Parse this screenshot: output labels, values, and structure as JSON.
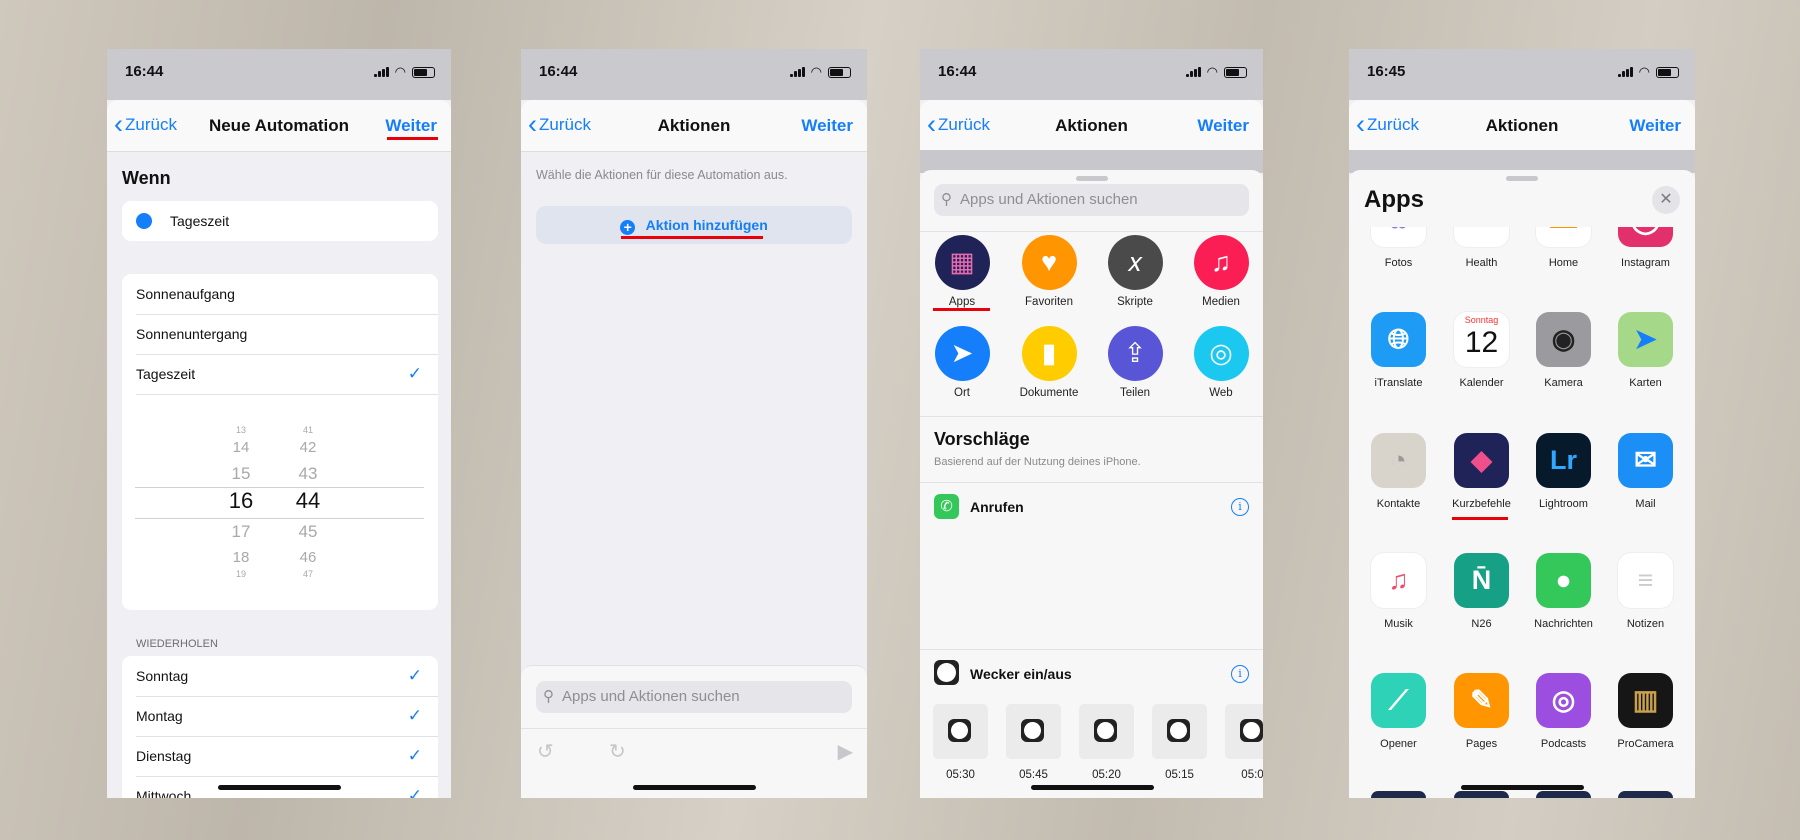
{
  "colors": {
    "accent": "#157efb",
    "highlight": "#e8000b"
  },
  "screens": [
    {
      "time": "16:44",
      "nav": {
        "back": "Zurück",
        "title": "Neue Automation",
        "next": "Weiter"
      },
      "when_header": "Wenn",
      "trigger": "Tageszeit",
      "options": [
        "Sonnenaufgang",
        "Sonnenuntergang",
        "Tageszeit"
      ],
      "selected_option": "Tageszeit",
      "picker": {
        "hours": [
          "13",
          "14",
          "15",
          "16",
          "17",
          "18",
          "19"
        ],
        "minutes": [
          "41",
          "42",
          "43",
          "44",
          "45",
          "46",
          "47"
        ],
        "selected": "16:44"
      },
      "repeat_header": "WIEDERHOLEN",
      "days": [
        "Sonntag",
        "Montag",
        "Dienstag",
        "Mittwoch"
      ]
    },
    {
      "time": "16:44",
      "nav": {
        "back": "Zurück",
        "title": "Aktionen",
        "next": "Weiter"
      },
      "subtitle": "Wähle die Aktionen für diese Automation aus.",
      "add_action": "Aktion hinzufügen",
      "search_placeholder": "Apps und Aktionen suchen"
    },
    {
      "time": "16:44",
      "nav": {
        "back": "Zurück",
        "title": "Aktionen",
        "next": "Weiter"
      },
      "search_placeholder": "Apps und Aktionen suchen",
      "categories": [
        {
          "label": "Apps",
          "icon": "apps-grid-icon",
          "color": "#1f2357"
        },
        {
          "label": "Favoriten",
          "icon": "heart-icon",
          "color": "#ff9500"
        },
        {
          "label": "Skripte",
          "icon": "script-x-icon",
          "color": "#4a4a4a"
        },
        {
          "label": "Medien",
          "icon": "music-note-icon",
          "color": "#fa1e55"
        },
        {
          "label": "Ort",
          "icon": "location-arrow-icon",
          "color": "#157efb"
        },
        {
          "label": "Dokumente",
          "icon": "document-icon",
          "color": "#ffcc00"
        },
        {
          "label": "Teilen",
          "icon": "share-icon",
          "color": "#5856d6"
        },
        {
          "label": "Web",
          "icon": "compass-icon",
          "color": "#1ac8f0"
        }
      ],
      "suggestions_title": "Vorschläge",
      "suggestions_subtitle": "Basierend auf der Nutzung deines iPhone.",
      "suggestions": [
        {
          "label": "Anrufen",
          "icon": "phone-icon"
        },
        {
          "label": "Wecker ein/aus",
          "icon": "clock-icon"
        }
      ],
      "alarms": [
        "05:30",
        "05:45",
        "05:20",
        "05:15",
        "05:0"
      ]
    },
    {
      "time": "16:45",
      "nav": {
        "back": "Zurück",
        "title": "Aktionen",
        "next": "Weiter"
      },
      "sheet_title": "Apps",
      "apps": [
        {
          "label": "Fotos",
          "icon": "photos-icon",
          "color": "#ffffff",
          "glyph": "✿",
          "fg": "#8e7bd6"
        },
        {
          "label": "Health",
          "icon": "health-icon",
          "color": "#ffffff",
          "glyph": "",
          "fg": "#f33"
        },
        {
          "label": "Home",
          "icon": "home-icon",
          "color": "#ffffff",
          "glyph": "▬",
          "fg": "#ff9500"
        },
        {
          "label": "Instagram",
          "icon": "instagram-icon",
          "color": "#e1306c",
          "glyph": "◯",
          "fg": "#fff"
        },
        {
          "label": "iTranslate",
          "icon": "globe-icon",
          "color": "#1e9bf5",
          "glyph": "🌐︎",
          "fg": "#fff"
        },
        {
          "label": "Kalender",
          "icon": "calendar-icon",
          "color": "#ffffff",
          "glyph": "12",
          "fg": "#111",
          "sub": "Sonntag"
        },
        {
          "label": "Kamera",
          "icon": "camera-icon",
          "color": "#9a9a9f",
          "glyph": "◉",
          "fg": "#222"
        },
        {
          "label": "Karten",
          "icon": "maps-icon",
          "color": "#a6d88a",
          "glyph": "➤",
          "fg": "#157efb"
        },
        {
          "label": "Kontakte",
          "icon": "contacts-icon",
          "color": "#d8d4cc",
          "glyph": "◔",
          "fg": "#9a9a9a"
        },
        {
          "label": "Kurzbefehle",
          "icon": "shortcuts-icon",
          "color": "#1f2357",
          "glyph": "◆",
          "fg": "#ef4f8a"
        },
        {
          "label": "Lightroom",
          "icon": "lightroom-icon",
          "color": "#061a2c",
          "glyph": "Lr",
          "fg": "#31a8ff"
        },
        {
          "label": "Mail",
          "icon": "mail-icon",
          "color": "#1b8ff5",
          "glyph": "✉",
          "fg": "#fff"
        },
        {
          "label": "Musik",
          "icon": "music-icon",
          "color": "#ffffff",
          "glyph": "♫",
          "fg": "#f04d6b"
        },
        {
          "label": "N26",
          "icon": "n26-icon",
          "color": "#16a085",
          "glyph": "N̄",
          "fg": "#fff"
        },
        {
          "label": "Nachrichten",
          "icon": "messages-icon",
          "color": "#34c759",
          "glyph": "●",
          "fg": "#fff"
        },
        {
          "label": "Notizen",
          "icon": "notes-icon",
          "color": "#ffffff",
          "glyph": "≡",
          "fg": "#ccc"
        },
        {
          "label": "Opener",
          "icon": "opener-icon",
          "color": "#2ed3b7",
          "glyph": "⟋",
          "fg": "#fff"
        },
        {
          "label": "Pages",
          "icon": "pages-icon",
          "color": "#ff9500",
          "glyph": "✎",
          "fg": "#fff"
        },
        {
          "label": "Podcasts",
          "icon": "podcasts-icon",
          "color": "#9b4ee0",
          "glyph": "◎",
          "fg": "#fff"
        },
        {
          "label": "ProCamera",
          "icon": "procamera-icon",
          "color": "#161616",
          "glyph": "▥",
          "fg": "#c9a14a"
        }
      ],
      "highlighted_app": "Kurzbefehle"
    }
  ]
}
